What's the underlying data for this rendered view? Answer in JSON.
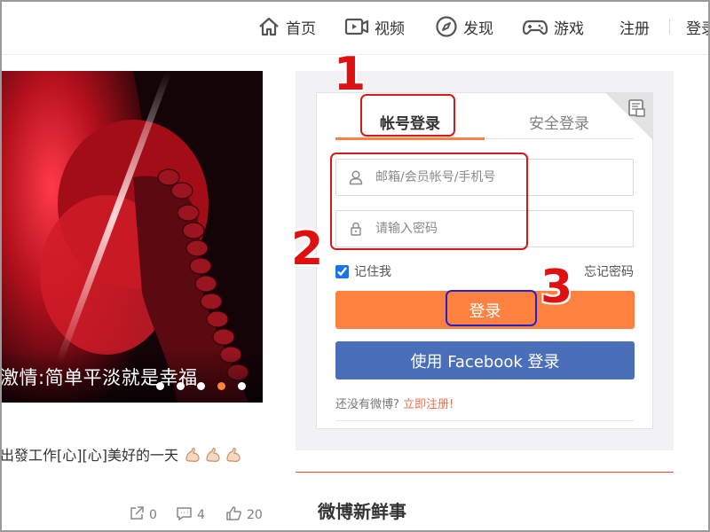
{
  "nav": {
    "home": "首页",
    "video": "视频",
    "discover": "发现",
    "game": "游戏",
    "register": "注册",
    "login": "登录"
  },
  "feed": {
    "carousel": {
      "caption": "激情:简单平淡就是幸福",
      "slide_count": 5,
      "active_slide": 4
    },
    "post": {
      "text": "出發工作[心][心]美好的一天",
      "emoji": [
        "flexed-biceps-emoji",
        "flexed-biceps-emoji",
        "flexed-biceps-emoji"
      ],
      "share_count": "0",
      "comment_count": "4",
      "like_count": "20"
    }
  },
  "login": {
    "tabs": {
      "account": "帐号登录",
      "safe": "安全登录"
    },
    "username": {
      "placeholder": "邮箱/会员帐号/手机号",
      "value": ""
    },
    "password": {
      "placeholder": "请输入密码",
      "value": ""
    },
    "remember_label": "记住我",
    "remember_checked": true,
    "forgot_label": "忘记密码",
    "login_button": "登录",
    "facebook_button": "使用 Facebook 登录",
    "signup_prompt": "还没有微博?",
    "signup_link": "立即注册!"
  },
  "news_title": "微博新鲜事",
  "annotations": [
    "1",
    "2",
    "3"
  ],
  "colors": {
    "accent": "#ff8140",
    "facebook": "#4b6eb9",
    "annotation_red": "#e01010",
    "annotation_blue": "#2222cc",
    "link": "#eb7350"
  },
  "icons": {
    "home": "home-icon",
    "video": "video-icon",
    "discover": "compass-icon",
    "game": "gamepad-icon",
    "username": "user-icon",
    "password": "lock-icon",
    "qr": "qr-login-icon",
    "share": "share-icon",
    "comment": "comment-icon",
    "like": "thumbs-up-icon"
  }
}
